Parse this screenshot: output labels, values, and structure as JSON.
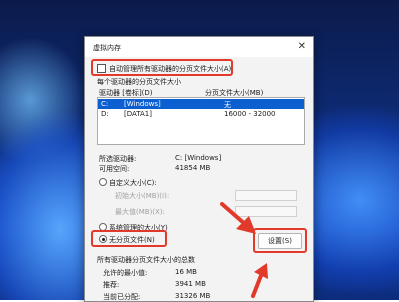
{
  "window": {
    "title": "虚拟内存",
    "close_glyph": "✕"
  },
  "auto_manage": {
    "label": "自动管理所有驱动器的分页文件大小(A)",
    "checked": false
  },
  "section_each_drive": "每个驱动器的分页文件大小",
  "drive_table": {
    "headers": {
      "drive": "驱动器 [卷标](D)",
      "size": "分页文件大小(MB)"
    },
    "rows": [
      {
        "drive": "C:",
        "label": "[Windows]",
        "size": "无",
        "selected": true
      },
      {
        "drive": "D:",
        "label": "[DATA1]",
        "size": "16000 - 32000",
        "selected": false
      }
    ]
  },
  "selected_drive": {
    "label": "所选驱动器:",
    "value": "C: [Windows]"
  },
  "free_space": {
    "label": "可用空间:",
    "value": "41854 MB"
  },
  "options": {
    "custom": "自定义大小(C):",
    "initial": "初始大小(MB)(I):",
    "max": "最大值(MB)(X):",
    "system_managed": "系统管理的大小(Y)",
    "no_paging": "无分页文件(N)",
    "selected": "no_paging"
  },
  "buttons": {
    "set": "设置(S)"
  },
  "totals": {
    "section": "所有驱动器分页文件大小的总数",
    "min_label": "允许的最小值:",
    "min_value": "16 MB",
    "rec_label": "推荐:",
    "rec_value": "3941 MB",
    "cur_label": "当前已分配:",
    "cur_value": "31326 MB"
  },
  "annotation_color": "#e23a2a"
}
